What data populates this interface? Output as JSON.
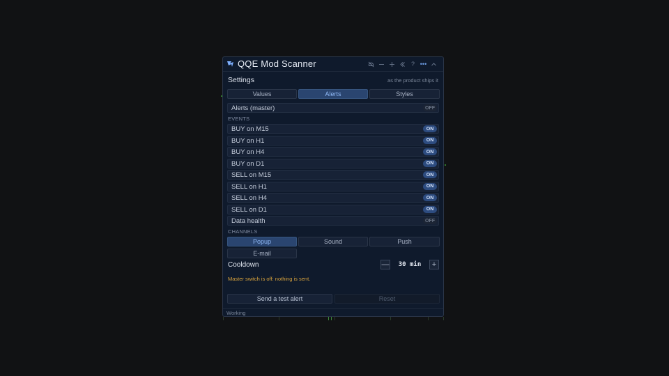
{
  "window": {
    "title": "QQE Mod Scanner",
    "titlebar_icons": [
      "bell-off-icon",
      "minimize-icon",
      "maximize-icon",
      "collapse-left-icon",
      "help-icon",
      "more-icon",
      "chevron-up-icon"
    ],
    "help_glyph": "?",
    "more_glyph": "•••"
  },
  "settings": {
    "title": "Settings",
    "subtitle": "as the product ships it"
  },
  "tabs": [
    {
      "label": "Values",
      "active": false
    },
    {
      "label": "Alerts",
      "active": true
    },
    {
      "label": "Styles",
      "active": false
    }
  ],
  "master": {
    "label": "Alerts (master)",
    "state": "OFF"
  },
  "events_header": "EVENTS",
  "events": [
    {
      "label": "BUY on M15",
      "state": "ON"
    },
    {
      "label": "BUY on H1",
      "state": "ON"
    },
    {
      "label": "BUY on H4",
      "state": "ON"
    },
    {
      "label": "BUY on D1",
      "state": "ON"
    },
    {
      "label": "SELL on M15",
      "state": "ON"
    },
    {
      "label": "SELL on H1",
      "state": "ON"
    },
    {
      "label": "SELL on H4",
      "state": "ON"
    },
    {
      "label": "SELL on D1",
      "state": "ON"
    },
    {
      "label": "Data health",
      "state": "OFF"
    }
  ],
  "channels_header": "CHANNELS",
  "channels": [
    {
      "label": "Popup",
      "active": true
    },
    {
      "label": "Sound",
      "active": false
    },
    {
      "label": "Push",
      "active": false
    },
    {
      "label": "E-mail",
      "active": false
    }
  ],
  "cooldown": {
    "label": "Cooldown",
    "value": "30 min",
    "minus": "—",
    "plus": "+"
  },
  "warning": "Master switch is off: nothing is sent.",
  "actions": {
    "test_label": "Send a test alert",
    "reset_label": "Reset"
  },
  "status": "Working",
  "colors": {
    "accent": "#2a4570",
    "on_pill": "#2d4c80",
    "warning": "#d8a33d",
    "panel_bg": "#0f1a2c"
  }
}
